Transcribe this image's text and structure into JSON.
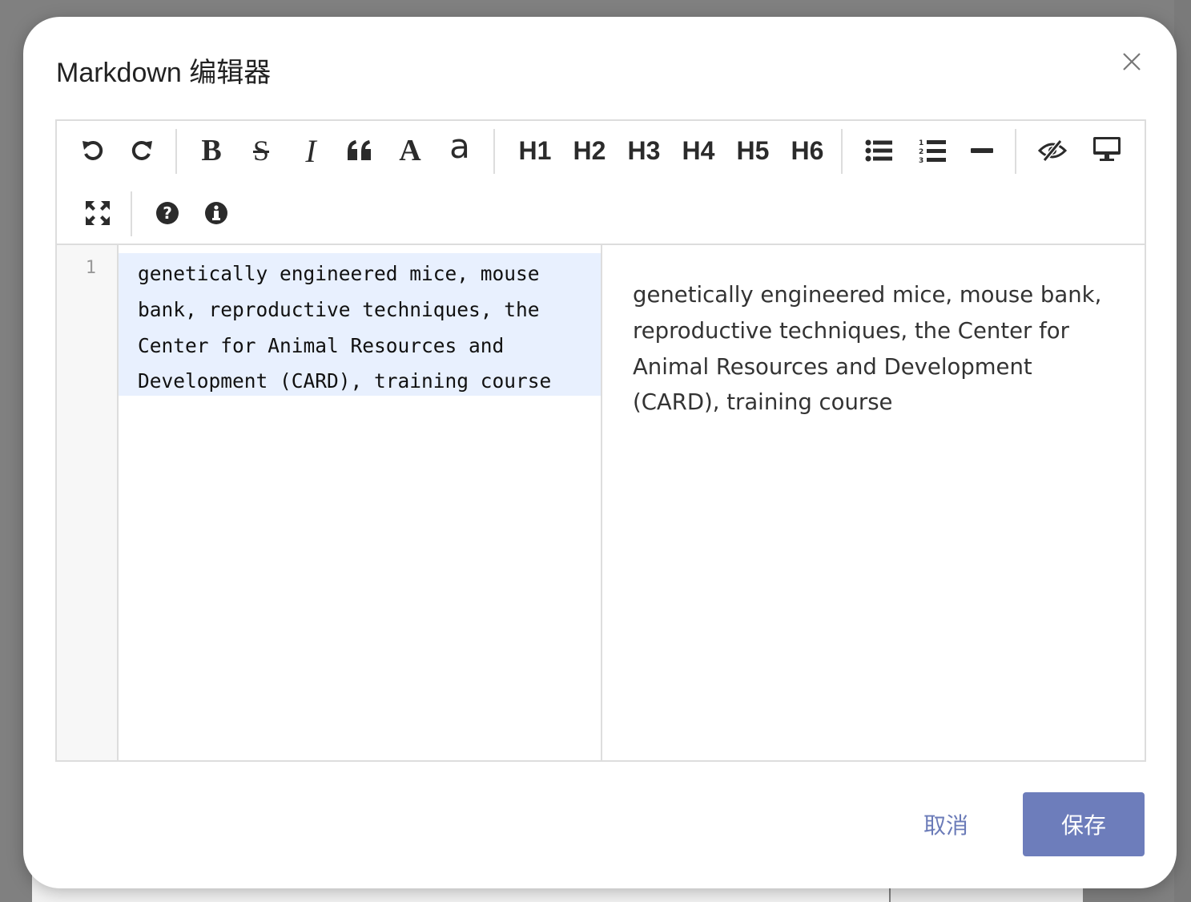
{
  "dialog": {
    "title": "Markdown 编辑器",
    "close_icon": "close-icon"
  },
  "toolbar": {
    "undo_icon": "undo-icon",
    "redo_icon": "redo-icon",
    "bold_label": "B",
    "strikethrough_label": "S",
    "italic_label": "I",
    "quote_icon": "quote-icon",
    "uppercase_label": "A",
    "lowercase_label": "a",
    "headings": [
      "H1",
      "H2",
      "H3",
      "H4",
      "H5",
      "H6"
    ],
    "list_ul_icon": "list-ul-icon",
    "list_ol_icon": "list-ol-icon",
    "hr_icon": "horizontal-rule-icon",
    "preview_toggle_icon": "eye-slash-icon",
    "fullscreen_preview_icon": "desktop-icon",
    "fullscreen_icon": "expand-icon",
    "help_icon": "question-circle-icon",
    "info_icon": "info-circle-icon"
  },
  "editor": {
    "line_number": "1",
    "content": "genetically engineered mice, mouse bank, reproductive techniques, the Center for Animal Resources and Development (CARD), training course"
  },
  "preview": {
    "content": "genetically engineered mice, mouse bank, reproductive techniques, the Center for Animal Resources and Development (CARD), training course"
  },
  "footer": {
    "cancel_label": "取消",
    "save_label": "保存"
  },
  "colors": {
    "accent": "#6d7dbb",
    "cancel_text": "#6b7bb8",
    "active_line": "#e8f0fe",
    "overlay": "#808080"
  }
}
